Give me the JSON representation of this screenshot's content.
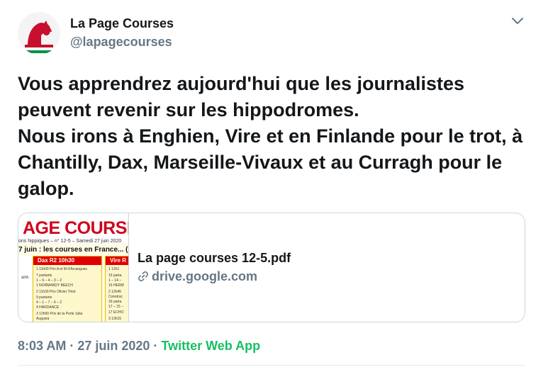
{
  "author": {
    "name": "La Page Courses",
    "handle": "@lapagecourses",
    "avatar_icon": "horse-logo-icon"
  },
  "menu": {
    "icon": "chevron-down-icon"
  },
  "tweet": {
    "lines": [
      "Vous apprendrez aujourd'hui que les journalistes peuvent revenir sur les hippodromes.",
      "Nous irons à Enghien, Vire et en Finlande pour le trot, à Chantilly, Dax, Marseille-Vivaux et au Curragh pour le galop."
    ]
  },
  "card": {
    "thumbnail": {
      "banner": "AGE COURSES",
      "subtitle": "ons hippiques – n° 12-5 – Samedi 27 juin 2020",
      "heading": "7 juin : les courses en France... (",
      "col1_head": "Dax R2 10h30",
      "col2_head": "Vire R",
      "col1_lines": [
        "1 11h00 Prix A et M d'Arcangues",
        "7 partants",
        "1 – 6 – 4 – 3 – 2",
        "1 NORMANDY BEECH",
        "2 11h30 Prix Olivier Tirlot",
        "9 partants",
        "4 – 1 – 7 – 6 – 2",
        "4 HARDANCE",
        "3 12h00 Prix de la Porte Julia",
        "Augusta"
      ],
      "col2_lines": [
        "1 12h1",
        "15 parta",
        "1 – 14 –",
        "15 HERM",
        "2 12h45",
        "Construc",
        "16 parta",
        "17 – 15 –",
        "17 ECHO",
        "3 13h15"
      ],
      "left_line": "aint-"
    },
    "title": "La page courses 12-5.pdf",
    "link": "drive.google.com",
    "link_icon": "link-icon"
  },
  "meta": {
    "time": "8:03 AM",
    "separator1": " · ",
    "date": "27 juin 2020",
    "separator2": " · ",
    "app": "Twitter Web App"
  },
  "colors": {
    "text": "#14171a",
    "secondary": "#657786",
    "app_green": "#17bf63",
    "border": "#ccd6dd",
    "thumb_red": "#d0021b"
  }
}
